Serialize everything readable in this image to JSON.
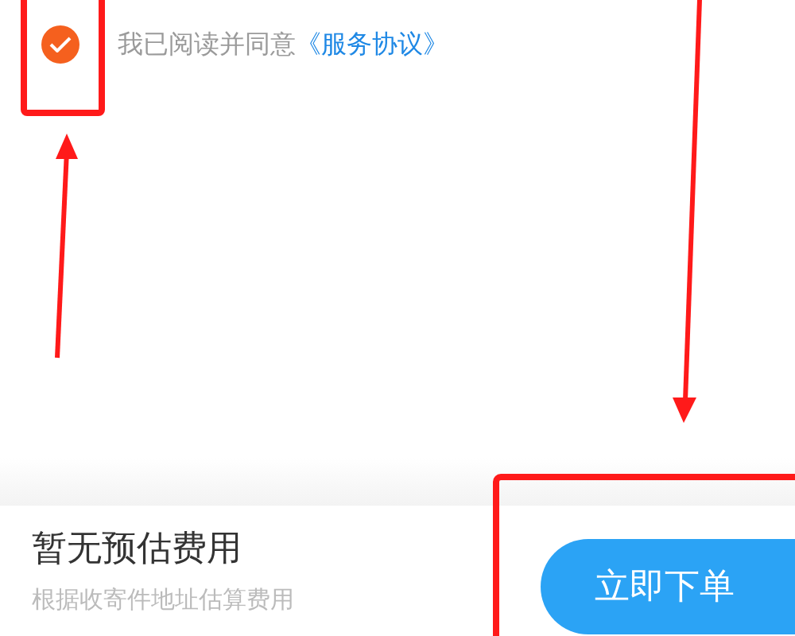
{
  "agreement": {
    "checked": true,
    "text": "我已阅读并同意",
    "link": "《服务协议》"
  },
  "bottom_bar": {
    "title": "暂无预估费用",
    "subtitle": "根据收寄件地址估算费用",
    "button": "立即下单"
  }
}
